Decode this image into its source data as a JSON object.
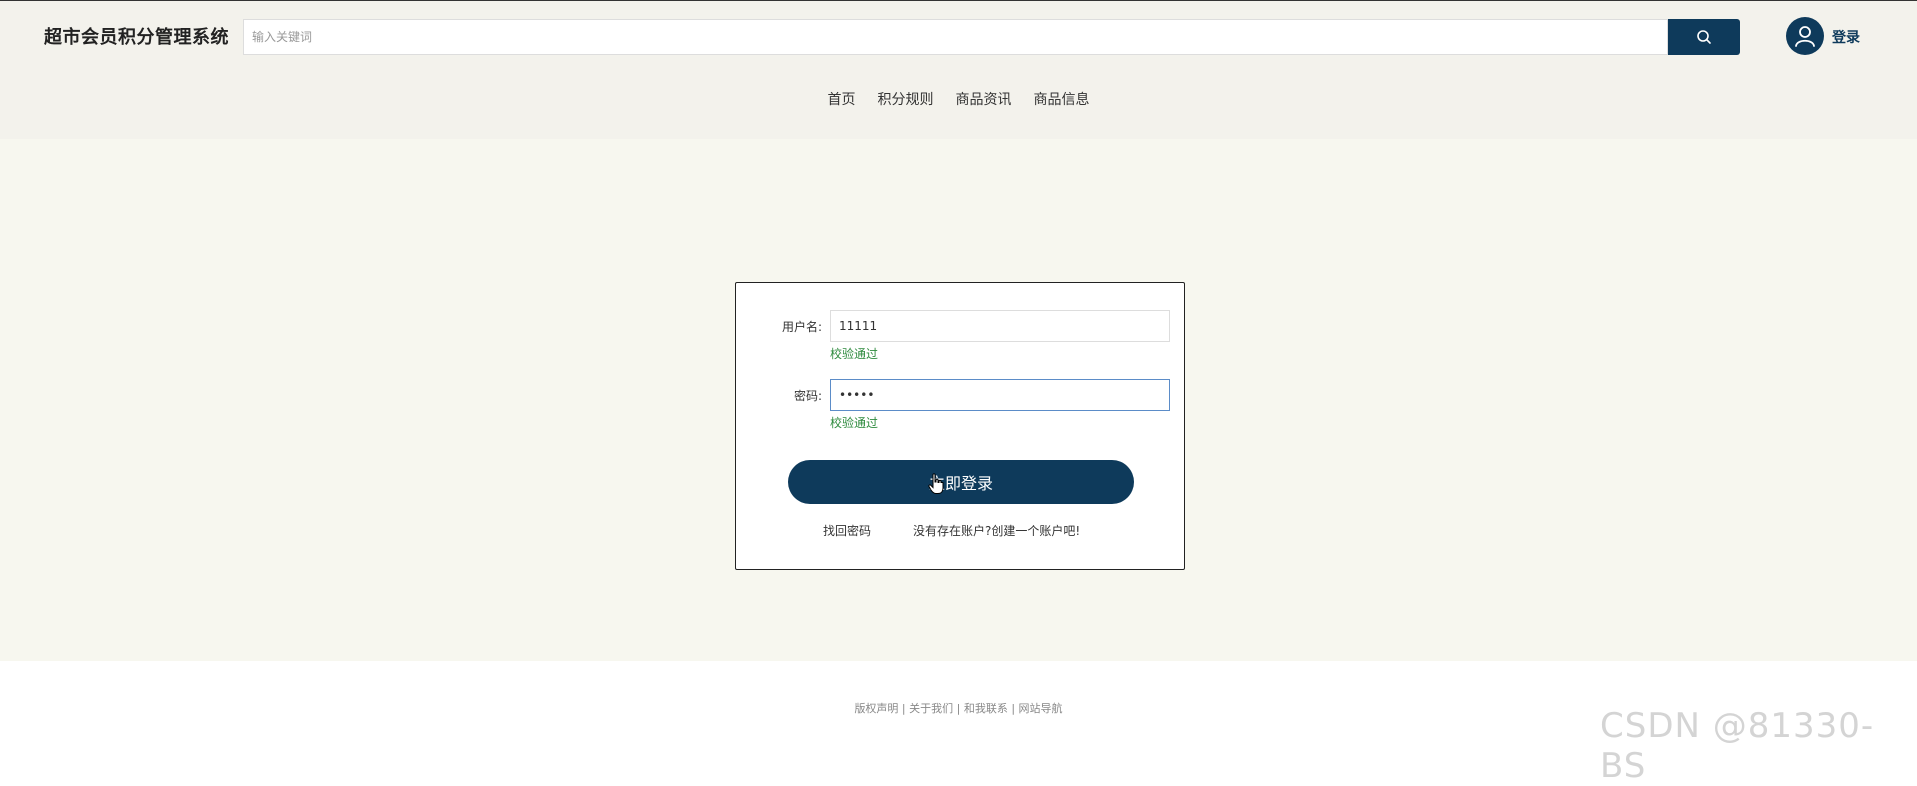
{
  "header": {
    "site_title": "超市会员积分管理系统",
    "search_placeholder": "输入关键词",
    "login_label": "登录"
  },
  "nav": {
    "items": [
      "首页",
      "积分规则",
      "商品资讯",
      "商品信息"
    ]
  },
  "login_form": {
    "username_label": "用户名:",
    "username_value": "11111",
    "username_status": "校验通过",
    "password_label": "密码:",
    "password_value": "•••••",
    "password_status": "校验通过",
    "submit_label": "立即登录",
    "forgot_link": "找回密码",
    "register_link": "没有存在账户?创建一个账户吧!"
  },
  "footer": {
    "links": [
      "版权声明",
      "关于我们",
      "和我联系",
      "网站导航"
    ],
    "separator": " | "
  },
  "watermark": "CSDN @81330-BS",
  "colors": {
    "primary": "#0e3a5b",
    "header_bg": "#f3f2ec",
    "main_bg": "#f7f7ef",
    "success": "#2e8b3e"
  }
}
